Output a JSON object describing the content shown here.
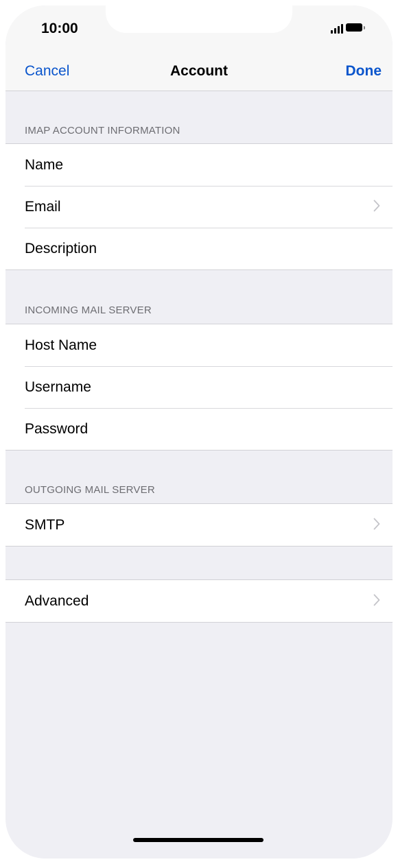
{
  "status_bar": {
    "time": "10:00",
    "signal_icon": "signal-bars-icon",
    "battery_icon": "battery-icon"
  },
  "nav": {
    "cancel_label": "Cancel",
    "title": "Account",
    "done_label": "Done"
  },
  "sections": {
    "imap": {
      "header": "IMAP ACCOUNT INFORMATION",
      "rows": [
        {
          "label": "Name"
        },
        {
          "label": "Email",
          "chevron": "chevron-right-icon"
        },
        {
          "label": "Description"
        }
      ]
    },
    "incoming": {
      "header": "INCOMING MAIL SERVER",
      "rows": [
        {
          "label": "Host Name"
        },
        {
          "label": "Username"
        },
        {
          "label": "Password"
        }
      ]
    },
    "outgoing": {
      "header": "OUTGOING MAIL SERVER",
      "rows": [
        {
          "label": "SMTP",
          "chevron": "chevron-right-icon"
        }
      ]
    },
    "advanced": {
      "rows": [
        {
          "label": "Advanced",
          "chevron": "chevron-right-icon"
        }
      ]
    }
  },
  "colors": {
    "accent": "#0a55cc",
    "grouped_background": "#efeff4",
    "section_header_text": "#6d6d72",
    "separator": "#d1d1d6"
  }
}
